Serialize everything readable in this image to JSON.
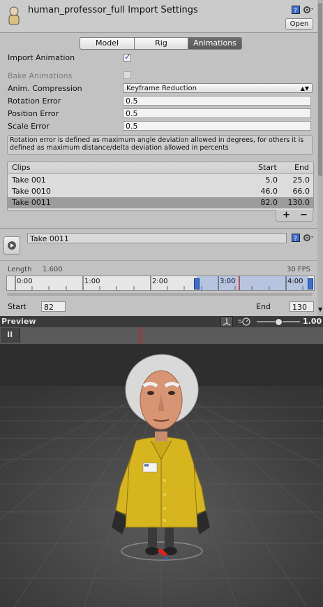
{
  "header": {
    "title": "human_professor_full Import Settings",
    "open_label": "Open"
  },
  "tabs": [
    {
      "label": "Model",
      "active": false
    },
    {
      "label": "Rig",
      "active": false
    },
    {
      "label": "Animations",
      "active": true
    }
  ],
  "settings": {
    "import_animation_label": "Import Animation",
    "import_animation_checked": true,
    "bake_animations_label": "Bake Animations",
    "bake_animations_checked": false,
    "anim_compression_label": "Anim. Compression",
    "anim_compression_value": "Keyframe Reduction",
    "rotation_error_label": "Rotation Error",
    "rotation_error_value": "0.5",
    "position_error_label": "Position Error",
    "position_error_value": "0.5",
    "scale_error_label": "Scale Error",
    "scale_error_value": "0.5",
    "help_text": "Rotation error is defined as maximum angle deviation allowed in degrees, for others it is defined as maximum distance/delta deviation allowed in percents"
  },
  "clips": {
    "headers": {
      "name": "Clips",
      "start": "Start",
      "end": "End"
    },
    "rows": [
      {
        "name": "Take 001",
        "start": "5.0",
        "end": "25.0",
        "selected": false
      },
      {
        "name": "Take 0010",
        "start": "46.0",
        "end": "66.0",
        "selected": false
      },
      {
        "name": "Take 0011",
        "start": "82.0",
        "end": "130.0",
        "selected": true
      }
    ],
    "add_label": "+",
    "remove_label": "−"
  },
  "clip_editor": {
    "name_value": "Take 0011",
    "length_label": "Length",
    "length_value": "1.600",
    "fps_label": "30 FPS",
    "ticks": [
      "0:00",
      "1:00",
      "2:00",
      "3:00",
      "4:00"
    ],
    "start_label": "Start",
    "start_value": "82",
    "end_label": "End",
    "end_value": "130"
  },
  "preview": {
    "title": "Preview",
    "speed_value": "1.00",
    "speed_fraction": 0.5,
    "pause_label": "II"
  },
  "colors": {
    "accent_blue": "#3c6fd0",
    "playhead_red": "#d02020",
    "coat_yellow": "#d6b51e"
  }
}
